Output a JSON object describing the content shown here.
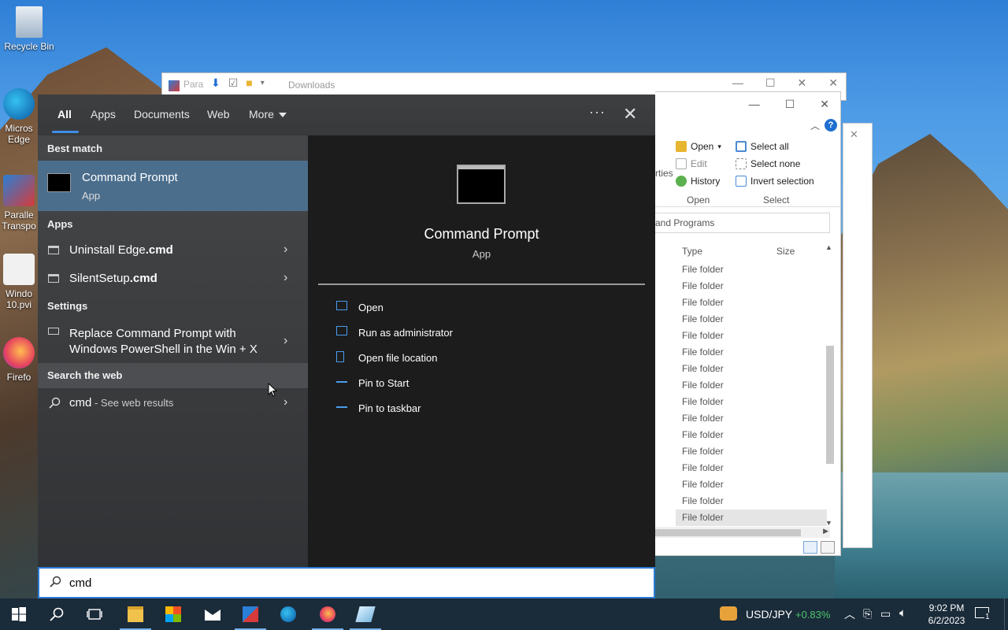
{
  "desktop": {
    "icons": [
      {
        "label": "Recycle Bin"
      },
      {
        "label": "Micros Edge"
      },
      {
        "label": "Paralle Transpo"
      },
      {
        "label": "Windo 10.pvi"
      },
      {
        "label": "Firefo"
      }
    ]
  },
  "back_window": {
    "para_label": "Para",
    "title": "Downloads"
  },
  "explorer": {
    "ribbon": {
      "open": "Open",
      "edit": "Edit",
      "history": "History",
      "open_caption": "Open",
      "select_all": "Select all",
      "select_none": "Select none",
      "invert_selection": "Invert selection",
      "select_caption": "Select",
      "properties_partial": "rties"
    },
    "address_partial": "and Programs",
    "columns": {
      "type": "Type",
      "size": "Size"
    },
    "rows": [
      "File folder",
      "File folder",
      "File folder",
      "File folder",
      "File folder",
      "File folder",
      "File folder",
      "File folder",
      "File folder",
      "File folder",
      "File folder",
      "File folder",
      "File folder",
      "File folder",
      "File folder",
      "File folder"
    ],
    "help": "?"
  },
  "search": {
    "tabs": [
      "All",
      "Apps",
      "Documents",
      "Web",
      "More"
    ],
    "more_menu": "···",
    "sections": {
      "best_match": "Best match",
      "apps": "Apps",
      "settings": "Settings",
      "search_web": "Search the web"
    },
    "best": {
      "title": "Command Prompt",
      "subtitle": "App"
    },
    "apps": [
      {
        "name": "Uninstall Edge",
        "ext": ".cmd"
      },
      {
        "name": "SilentSetup",
        "ext": ".cmd"
      }
    ],
    "settings_item": {
      "line1": "Replace Command Prompt with",
      "line2": "Windows PowerShell in the Win + X"
    },
    "web_item": {
      "query": "cmd",
      "suffix": " - See web results"
    },
    "detail": {
      "title": "Command Prompt",
      "subtitle": "App",
      "actions": [
        "Open",
        "Run as administrator",
        "Open file location",
        "Pin to Start",
        "Pin to taskbar"
      ]
    },
    "query": "cmd"
  },
  "taskbar": {
    "currency": "USD/JPY",
    "change": "+0.83%",
    "time": "9:02 PM",
    "date": "6/2/2023",
    "notifications": "1"
  },
  "colors": {
    "accent": "#3f8fe8",
    "selected_row": "#4b6e8d",
    "positive": "#4cc76b"
  }
}
